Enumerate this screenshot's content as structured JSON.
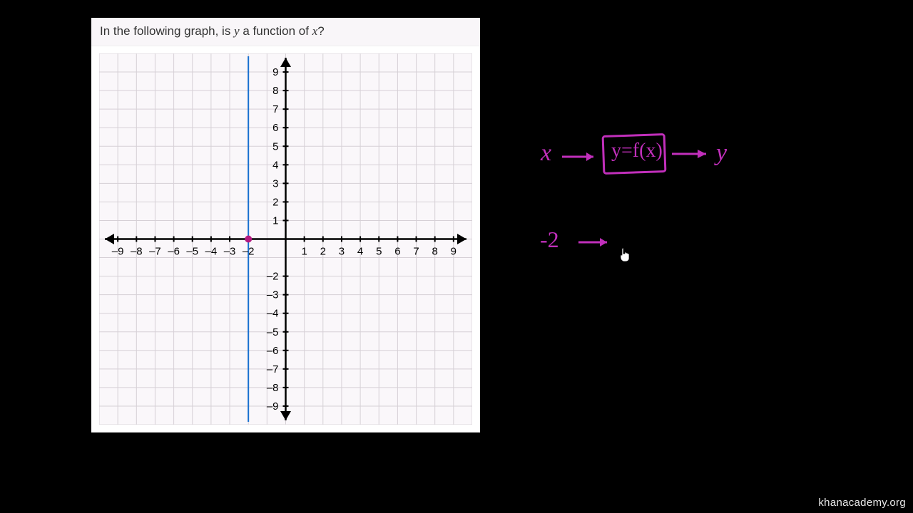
{
  "question": {
    "prefix": "In the following graph, is ",
    "var1": "y",
    "middle": " a function of ",
    "var2": "x",
    "suffix": "?"
  },
  "chart_data": {
    "type": "line",
    "title": "",
    "xlabel": "",
    "ylabel": "",
    "xlim": [
      -10,
      10
    ],
    "ylim": [
      -10,
      10
    ],
    "x_ticks": [
      -9,
      -8,
      -7,
      -6,
      -5,
      -4,
      -3,
      -2,
      1,
      2,
      3,
      4,
      5,
      6,
      7,
      8,
      9
    ],
    "y_ticks_pos": [
      9,
      8,
      7,
      6,
      5,
      4,
      3,
      2,
      1
    ],
    "y_ticks_neg": [
      -2,
      -3,
      -4,
      -5,
      -6,
      -7,
      -8,
      -9
    ],
    "gridlines": true,
    "series": [
      {
        "name": "vertical line x = -2",
        "type": "vertical_line",
        "x": -2
      }
    ],
    "points": [
      {
        "x": -2,
        "y": 0
      }
    ]
  },
  "handwriting": {
    "x_symbol": "x",
    "box_text": "y=f(x)",
    "y_symbol": "y",
    "input_value": "-2"
  },
  "footer": "khanacademy.org"
}
